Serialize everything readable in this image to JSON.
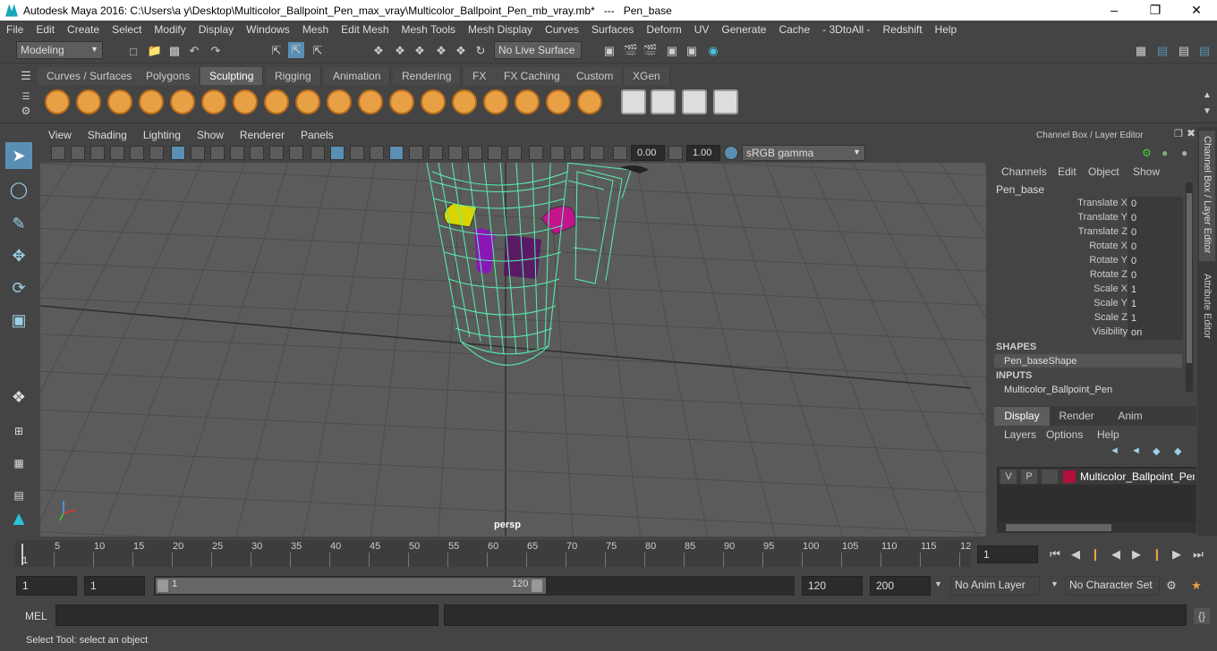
{
  "window": {
    "title": "Autodesk Maya 2016: C:\\Users\\a y\\Desktop\\Multicolor_Ballpoint_Pen_max_vray\\Multicolor_Ballpoint_Pen_mb_vray.mb*   ---   Pen_base"
  },
  "menubar": [
    "File",
    "Edit",
    "Create",
    "Select",
    "Modify",
    "Display",
    "Windows",
    "Mesh",
    "Edit Mesh",
    "Mesh Tools",
    "Mesh Display",
    "Curves",
    "Surfaces",
    "Deform",
    "UV",
    "Generate",
    "Cache",
    "- 3DtoAll -",
    "Redshift",
    "Help"
  ],
  "statusline": {
    "mode": "Modeling",
    "live_surface": "No Live Surface"
  },
  "shelf_tabs": [
    "Curves / Surfaces",
    "Polygons",
    "Sculpting",
    "Rigging",
    "Animation",
    "Rendering",
    "FX",
    "FX Caching",
    "Custom",
    "XGen"
  ],
  "shelf_active": "Sculpting",
  "viewport": {
    "menu": [
      "View",
      "Shading",
      "Lighting",
      "Show",
      "Renderer",
      "Panels"
    ],
    "exposure": "0.00",
    "gamma": "1.00",
    "colorspace": "sRGB gamma",
    "camera_label": "persp"
  },
  "channelbox": {
    "title": "Channel Box / Layer Editor",
    "menu": [
      "Channels",
      "Edit",
      "Object",
      "Show"
    ],
    "object": "Pen_base",
    "channels": [
      {
        "name": "Translate X",
        "value": "0"
      },
      {
        "name": "Translate Y",
        "value": "0"
      },
      {
        "name": "Translate Z",
        "value": "0"
      },
      {
        "name": "Rotate X",
        "value": "0"
      },
      {
        "name": "Rotate Y",
        "value": "0"
      },
      {
        "name": "Rotate Z",
        "value": "0"
      },
      {
        "name": "Scale X",
        "value": "1"
      },
      {
        "name": "Scale Y",
        "value": "1"
      },
      {
        "name": "Scale Z",
        "value": "1"
      },
      {
        "name": "Visibility",
        "value": "on"
      }
    ],
    "shapes_header": "SHAPES",
    "shape": "Pen_baseShape",
    "inputs_header": "INPUTS",
    "input": "Multicolor_Ballpoint_Pen",
    "layer_tabs": [
      "Display",
      "Render",
      "Anim"
    ],
    "layer_menu": [
      "Layers",
      "Options",
      "Help"
    ],
    "layer": {
      "v": "V",
      "p": "P",
      "name": "Multicolor_Ballpoint_Pen",
      "color": "#b0103a"
    }
  },
  "side_tabs": [
    "Channel Box / Layer Editor",
    "Attribute Editor"
  ],
  "timeline": {
    "ticks": [
      "5",
      "10",
      "15",
      "20",
      "25",
      "30",
      "35",
      "40",
      "45",
      "50",
      "55",
      "60",
      "65",
      "70",
      "75",
      "80",
      "85",
      "90",
      "95",
      "100",
      "105",
      "110",
      "115",
      "12"
    ],
    "start_marker": "1",
    "current_frame": "1"
  },
  "range": {
    "start": "1",
    "playback_start": "1",
    "slider_start": "1",
    "slider_end": "120",
    "playback_end": "120",
    "end": "200",
    "anim_layer": "No Anim Layer",
    "character_set": "No Character Set"
  },
  "mel_label": "MEL",
  "help_line": "Select Tool: select an object"
}
